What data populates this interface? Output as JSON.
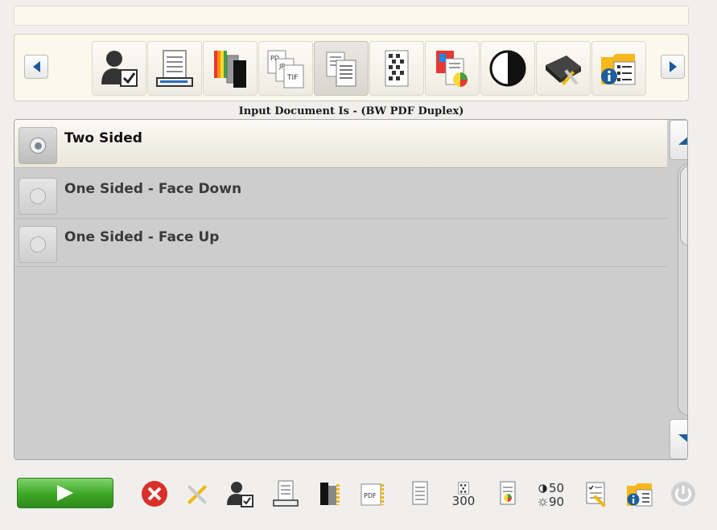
{
  "status_text": "",
  "section_title": "Input Document Is - (BW PDF Duplex)",
  "toolbar": {
    "active_index": 4,
    "items": [
      {
        "name": "user-settings"
      },
      {
        "name": "scanner-document"
      },
      {
        "name": "color-pages"
      },
      {
        "name": "file-format"
      },
      {
        "name": "input-document"
      },
      {
        "name": "resolution"
      },
      {
        "name": "color-detection"
      },
      {
        "name": "contrast"
      },
      {
        "name": "scanner-tools"
      },
      {
        "name": "information"
      }
    ]
  },
  "options": [
    {
      "label": "Two Sided",
      "selected": true
    },
    {
      "label": "One Sided - Face Down",
      "selected": false
    },
    {
      "label": "One Sided - Face Up",
      "selected": false
    }
  ],
  "bottom": {
    "resolution_label": "300",
    "brightness_label": "50",
    "contrast_label": "90"
  },
  "colors": {
    "accent_blue": "#1c5e9e",
    "start_green": "#3da626",
    "cancel_red": "#d9302c"
  }
}
